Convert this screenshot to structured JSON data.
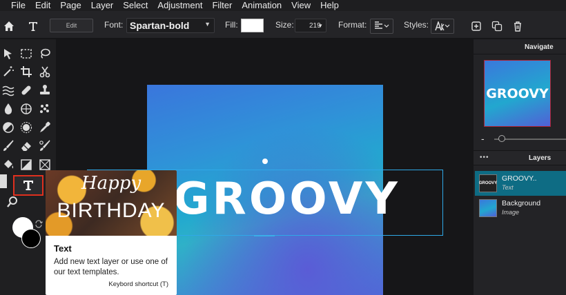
{
  "menu": [
    "File",
    "Edit",
    "Page",
    "Layer",
    "Select",
    "Adjustment",
    "Filter",
    "Animation",
    "View",
    "Help"
  ],
  "toolbar": {
    "edit_label": "Edit",
    "font_label": "Font:",
    "font_value": "Spartan-bold",
    "fill_label": "Fill:",
    "fill_color": "#ffffff",
    "size_label": "Size:",
    "size_value": "219",
    "format_label": "Format:",
    "styles_label": "Styles:",
    "format_icon": "align-icon",
    "styles_icon": "text-style-icon"
  },
  "tools": [
    "select-arrow-icon",
    "marquee-icon",
    "lasso-icon",
    "wand-icon",
    "crop-icon",
    "cut-icon",
    "liquify-icon",
    "healing-icon",
    "stamp-icon",
    "blur-drop-icon",
    "sponge-icon",
    "dots-icon",
    "dodge-icon",
    "burn-icon",
    "eyedropper-icon",
    "brush-icon",
    "eraser-icon",
    "clone-brush-icon",
    "bucket-icon",
    "gradient-icon",
    "frame-icon",
    "text-tool-icon",
    "zoom-icon",
    "hand-icon"
  ],
  "canvas": {
    "text": "GROOVY"
  },
  "tooltip": {
    "image_line1": "Happy",
    "image_line2": "BIRTHDAY",
    "title": "Text",
    "description": "Add new text layer or use one of our text templates.",
    "shortcut": "Keybord shortcut (T)"
  },
  "navigate": {
    "title": "Navigate",
    "thumb_text": "GROOVY",
    "zoom_minus": "-"
  },
  "layers": {
    "title": "Layers",
    "more": "•••",
    "items": [
      {
        "name": "GROOVY..",
        "type": "Text",
        "thumb_text": "GROOVY"
      },
      {
        "name": "Background",
        "type": "Image",
        "thumb_text": ""
      }
    ]
  },
  "colors": {
    "accent": "#2fa9e8",
    "selected_layer": "#0e6c84",
    "tool_highlight": "#e0301e"
  }
}
